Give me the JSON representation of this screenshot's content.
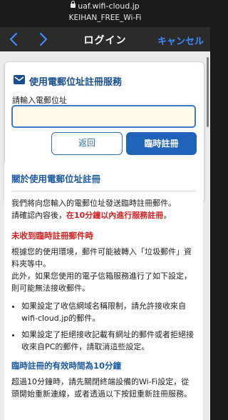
{
  "statusbar": {
    "url": "uaf.wifi-cloud.jp",
    "ssid": "KEIHAN_FREE_Wi-Fi"
  },
  "navbar": {
    "title": "ログイン",
    "cancel_label": "キャンセル"
  },
  "form": {
    "heading": "使用電郵位址註冊服務",
    "email_label": "請輸入電郵位址",
    "email_value": "",
    "back_label": "返回",
    "register_label": "臨時註冊"
  },
  "info": {
    "title": "關於使用電郵位址註冊",
    "intro_1": "我們將向您輸入的電郵位址發送臨時註冊郵件。",
    "intro_2_prefix": "請確認內容後，",
    "intro_2_red": "在10分鐘以內進行服務註冊",
    "intro_2_suffix": "。",
    "sub_title_1": "未收到臨時註冊郵件時",
    "body_1": "根據您的使用環境，郵件可能被轉入「垃圾郵件」資料夾等中。",
    "body_2": "此外，如果您使用的電子信箱服務進行了如下設定，則可能無法接收郵件。",
    "bullets": [
      "如果設定了收信網域名稱限制，請允許接收來自wifi-cloud.jp的郵件。",
      "如果設定了拒絕接收記載有網址的郵件或者拒絕接收來自PC的郵件，請取消這些設定。"
    ],
    "sub_title_2": "臨時註冊的有效時間為10分鐘",
    "body_3": "超過10分鐘時，請先關閉終端設備的Wi-Fi設定，從頭開始重新連線，或者透過以下按鈕重新註冊服務。"
  }
}
